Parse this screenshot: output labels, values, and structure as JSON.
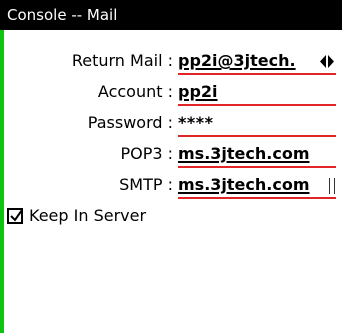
{
  "window": {
    "title": "Console -- Mail"
  },
  "fields": [
    {
      "label": "Return Mail :",
      "value": "pp2i@3jtech.",
      "has_scroll_icon": true,
      "masked": false
    },
    {
      "label": "Account :",
      "value": "pp2i",
      "has_scroll_icon": false,
      "masked": false
    },
    {
      "label": "Password :",
      "value": "****",
      "has_scroll_icon": false,
      "masked": true
    },
    {
      "label": "POP3 :",
      "value": "ms.3jtech.com",
      "has_scroll_icon": false,
      "masked": false
    },
    {
      "label": "SMTP :",
      "value": "ms.3jtech.com",
      "has_scroll_icon": false,
      "masked": false
    }
  ],
  "options": {
    "keep_in_server": {
      "label": "Keep In Server",
      "checked": true
    }
  },
  "colors": {
    "left_bar": "#0fc40f",
    "title_bg": "#000000",
    "field_underline": "#e32424"
  },
  "icons": {
    "return_mail_scroll": "left-right-arrows-icon",
    "checkbox_mark": "check-icon"
  }
}
